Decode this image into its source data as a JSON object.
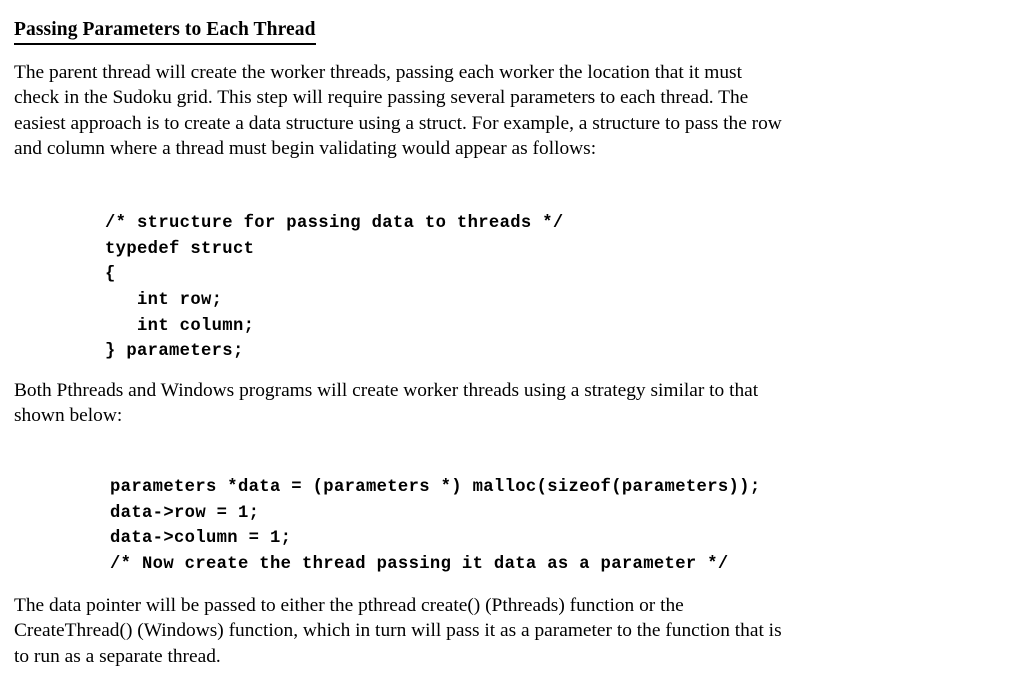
{
  "document": {
    "title": "Passing Parameters to Each Thread",
    "background_color": "#ffffff",
    "text_color": "#000000"
  },
  "paragraphs": {
    "intro": {
      "lines": [
        "The parent thread will create the worker threads, passing each worker the location that it must",
        "check in the Sudoku grid. This step will require passing several parameters to each thread. The",
        "easiest approach is to create a data structure using a struct. For example, a structure to pass the row",
        "and column where a thread must begin validating would appear as follows:"
      ]
    },
    "middle": {
      "lines": [
        "Both Pthreads and Windows programs will create worker threads using a strategy similar to that",
        "shown below:"
      ]
    },
    "outro": {
      "lines": [
        "The data pointer will be passed to either the pthread create() (Pthreads) function or the",
        "CreateThread() (Windows) function, which in turn will pass it as a parameter to the function that is",
        "to run as a separate thread."
      ]
    }
  },
  "code_blocks": {
    "struct_definition": {
      "language": "c",
      "lines": [
        "/* structure for passing data to threads */",
        "typedef struct",
        "{",
        "   int row;",
        "   int column;",
        "} parameters;"
      ]
    },
    "thread_creation": {
      "language": "c",
      "lines": [
        "parameters *data = (parameters *) malloc(sizeof(parameters));",
        "data->row = 1;",
        "data->column = 1;",
        "/* Now create the thread passing it data as a parameter */"
      ]
    }
  }
}
